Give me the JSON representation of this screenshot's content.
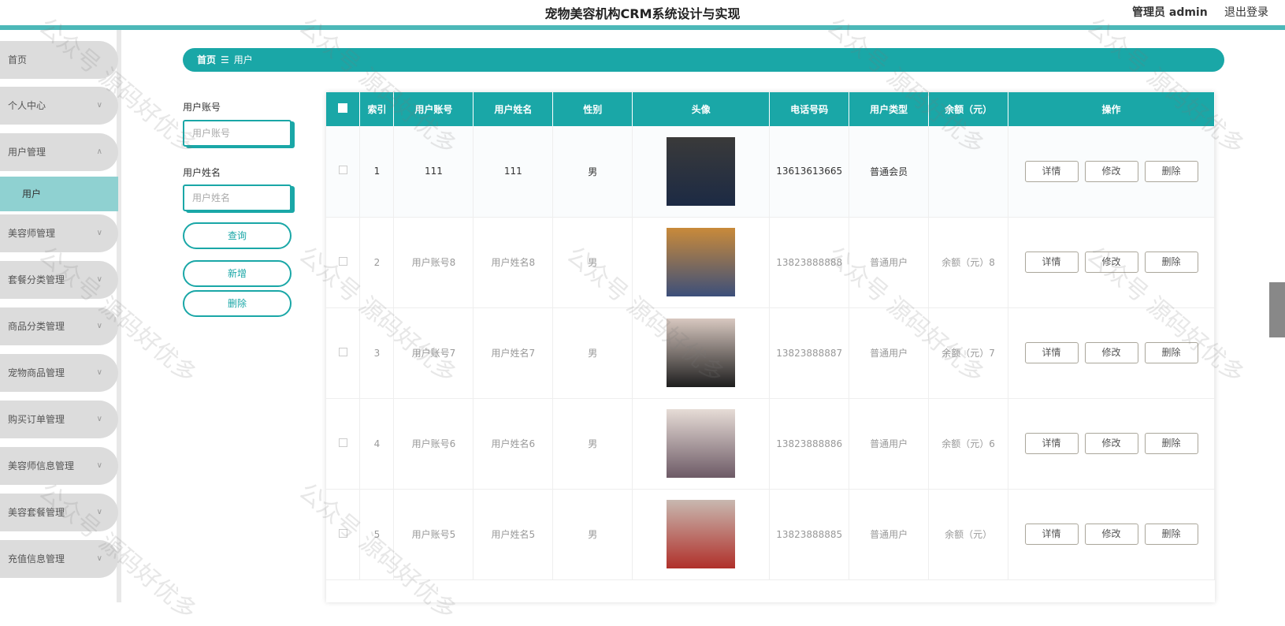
{
  "header": {
    "title": "宠物美容机构CRM系统设计与实现",
    "user": "管理员 admin",
    "logout": "退出登录"
  },
  "sidebar": {
    "items": [
      {
        "label": "首页",
        "chevron": ""
      },
      {
        "label": "个人中心",
        "chevron": "∨"
      },
      {
        "label": "用户管理",
        "chevron": "∧"
      },
      {
        "label": "美容师管理",
        "chevron": "∨"
      },
      {
        "label": "套餐分类管理",
        "chevron": "∨"
      },
      {
        "label": "商品分类管理",
        "chevron": "∨"
      },
      {
        "label": "宠物商品管理",
        "chevron": "∨"
      },
      {
        "label": "购买订单管理",
        "chevron": "∨"
      },
      {
        "label": "美容师信息管理",
        "chevron": "∨"
      },
      {
        "label": "美容套餐管理",
        "chevron": "∨"
      },
      {
        "label": "充值信息管理",
        "chevron": "∨"
      }
    ],
    "sub_item": "用户"
  },
  "breadcrumb": {
    "home": "首页",
    "sep": "☰",
    "current": "用户"
  },
  "search": {
    "account_label": "用户账号",
    "account_placeholder": "用户账号",
    "name_label": "用户姓名",
    "name_placeholder": "用户姓名",
    "query_button": "查询",
    "add_button": "新增",
    "delete_button": "删除"
  },
  "table": {
    "headers": [
      "索引",
      "用户账号",
      "用户姓名",
      "性别",
      "头像",
      "电话号码",
      "用户类型",
      "余额（元）",
      "操作"
    ],
    "actions": {
      "detail": "详情",
      "edit": "修改",
      "delete": "删除"
    },
    "rows": [
      {
        "index": "1",
        "account": "111",
        "name": "111",
        "gender": "男",
        "phone": "13613613665",
        "type": "普通会员",
        "balance": ""
      },
      {
        "index": "2",
        "account": "用户账号8",
        "name": "用户姓名8",
        "gender": "男",
        "phone": "13823888888",
        "type": "普通用户",
        "balance": "余额（元）8"
      },
      {
        "index": "3",
        "account": "用户账号7",
        "name": "用户姓名7",
        "gender": "男",
        "phone": "13823888887",
        "type": "普通用户",
        "balance": "余额（元）7"
      },
      {
        "index": "4",
        "account": "用户账号6",
        "name": "用户姓名6",
        "gender": "男",
        "phone": "13823888886",
        "type": "普通用户",
        "balance": "余额（元）6"
      },
      {
        "index": "5",
        "account": "用户账号5",
        "name": "用户姓名5",
        "gender": "男",
        "phone": "13823888885",
        "type": "普通用户",
        "balance": "余额（元）"
      }
    ]
  },
  "watermark": "公众号 源码好优多",
  "colors": {
    "accent": "#1aa7a7",
    "topline": "#4cb8b8",
    "sidebar_active": "#8fd1d1",
    "sidebar_item": "#dcdcdc"
  }
}
